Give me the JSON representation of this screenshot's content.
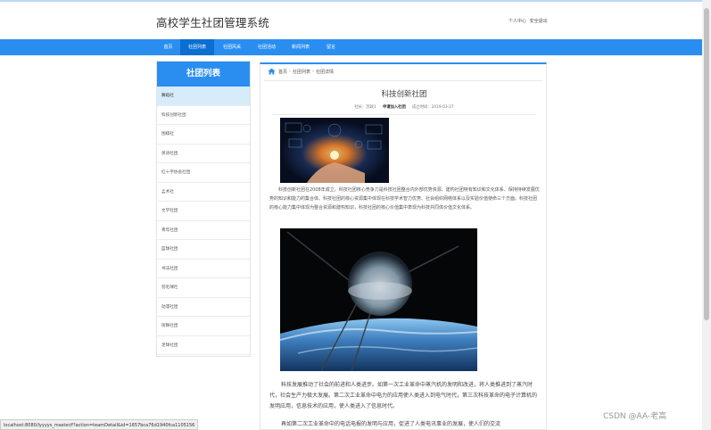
{
  "header": {
    "site_title": "高校学生社团管理系统",
    "user_center": "个人中心",
    "logout": "安全退出"
  },
  "nav": {
    "items": [
      "首页",
      "社团列表",
      "社团风采",
      "社团活动",
      "新闻列表",
      "留言"
    ],
    "active_index": 1
  },
  "sidebar": {
    "title": "社团列表",
    "items": [
      "舞蹈社",
      "科技创新社团",
      "围棋社",
      "英语社团",
      "红十字协会社团",
      "孟术社",
      "文学社团",
      "青年社团",
      "篮球社团",
      "书法社团",
      "羽毛球社",
      "动漫社团",
      "街舞社团",
      "足球社团"
    ],
    "active_index": 0
  },
  "breadcrumb": {
    "home": "首页",
    "list": "社团列表",
    "detail": "社团详情"
  },
  "article": {
    "title": "科技创新社团",
    "meta": {
      "leader_label": "社长：",
      "leader_value": "苏政1",
      "join_button": "申请加入社团",
      "founded_label": "成立时间：",
      "founded_value": "2019-03-27"
    },
    "paragraph1": "科技创新社团在2008年成立。科技社团核心竞争力是科技社团整合内外部优势资源、建构社团特有知识和文化体系、保持持续发展优势的知识和能力的集合体。科技社团的核心资源集中体现在科技学术智力优势、社会组织网络体系以及实验价值使命三个方面。科技社团的核心能力集中体现为整合资源和建构知识，科技社团的核心价值集中表现为科技共同体价值文化体系。",
    "paragraph2": "科技发展推动了社会的前进和人类进步。如第一次工业革命中蒸汽机的发明和改进，将人类推进到了蒸汽时代，社会生产力极大发展。第二次工业革命中电力的应用使人类进入到电气时代，第三次科技革命的电子计算机的发明应用，信息技术的应用，使人类进入了信息时代。",
    "paragraph3": "再如第二次工业革命中的电话电报的发明与应用，促进了人类电讯事业的发展，使人们的交流"
  },
  "status_bar": {
    "url": "localhost:8080/lyyyys_master/f?action=teamDetail&id=1657bca76d1940fca1105156"
  },
  "watermark": "CSDN @AA-老高",
  "colors": {
    "accent": "#2a8ef0",
    "nav_active": "#0b6fd2",
    "sidebar_active": "#d6ecfb"
  }
}
